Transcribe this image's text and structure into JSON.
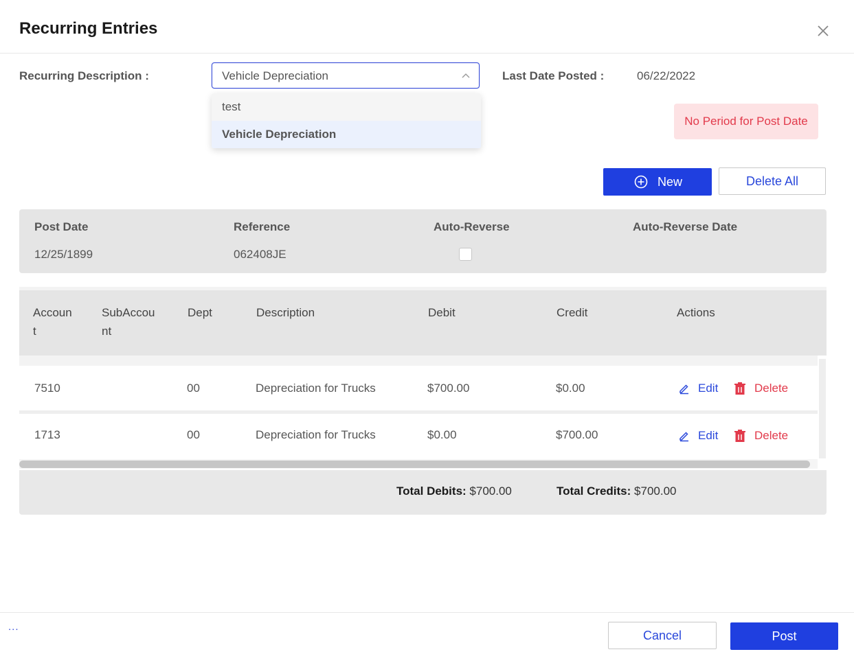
{
  "dialog": {
    "title": "Recurring Entries"
  },
  "form": {
    "recurring_description_label": "Recurring Description :",
    "recurring_description_value": "Vehicle Depreciation",
    "dropdown_options": [
      "test",
      "Vehicle Depreciation"
    ],
    "last_date_posted_label": "Last Date Posted :",
    "last_date_posted_value": "06/22/2022"
  },
  "alert": {
    "text": "No Period for Post Date"
  },
  "buttons": {
    "new_label": "New",
    "delete_all_label": "Delete All",
    "cancel_label": "Cancel",
    "post_label": "Post"
  },
  "post_panel": {
    "headers": [
      "Post Date",
      "Reference",
      "Auto-Reverse",
      "Auto-Reverse Date"
    ],
    "post_date": "12/25/1899",
    "reference": "062408JE",
    "auto_reverse_checked": false,
    "auto_reverse_date": ""
  },
  "table": {
    "headers": [
      {
        "line1": "Accoun",
        "line2": "t"
      },
      {
        "line1": "SubAccou",
        "line2": "nt"
      },
      {
        "line1": "Dept",
        "line2": ""
      },
      {
        "line1": "Description",
        "line2": ""
      },
      {
        "line1": "Debit",
        "line2": ""
      },
      {
        "line1": "Credit",
        "line2": ""
      },
      {
        "line1": "Actions",
        "line2": ""
      }
    ],
    "rows": [
      {
        "account": "7510",
        "subaccount": "",
        "dept": "00",
        "description": "Depreciation for Trucks",
        "debit": "$700.00",
        "credit": "$0.00",
        "edit": "Edit",
        "delete": "Delete"
      },
      {
        "account": "1713",
        "subaccount": "",
        "dept": "00",
        "description": "Depreciation for Trucks",
        "debit": "$0.00",
        "credit": "$700.00",
        "edit": "Edit",
        "delete": "Delete"
      }
    ]
  },
  "totals": {
    "debits_label": "Total Debits:",
    "debits_value": "$700.00",
    "credits_label": "Total Credits:",
    "credits_value": "$700.00"
  },
  "footer": {
    "ellipsis": "..."
  },
  "colors": {
    "primary": "#1f3fe0",
    "link": "#2a48db",
    "danger": "#e23a4b",
    "alert_bg": "#fde2e4"
  }
}
